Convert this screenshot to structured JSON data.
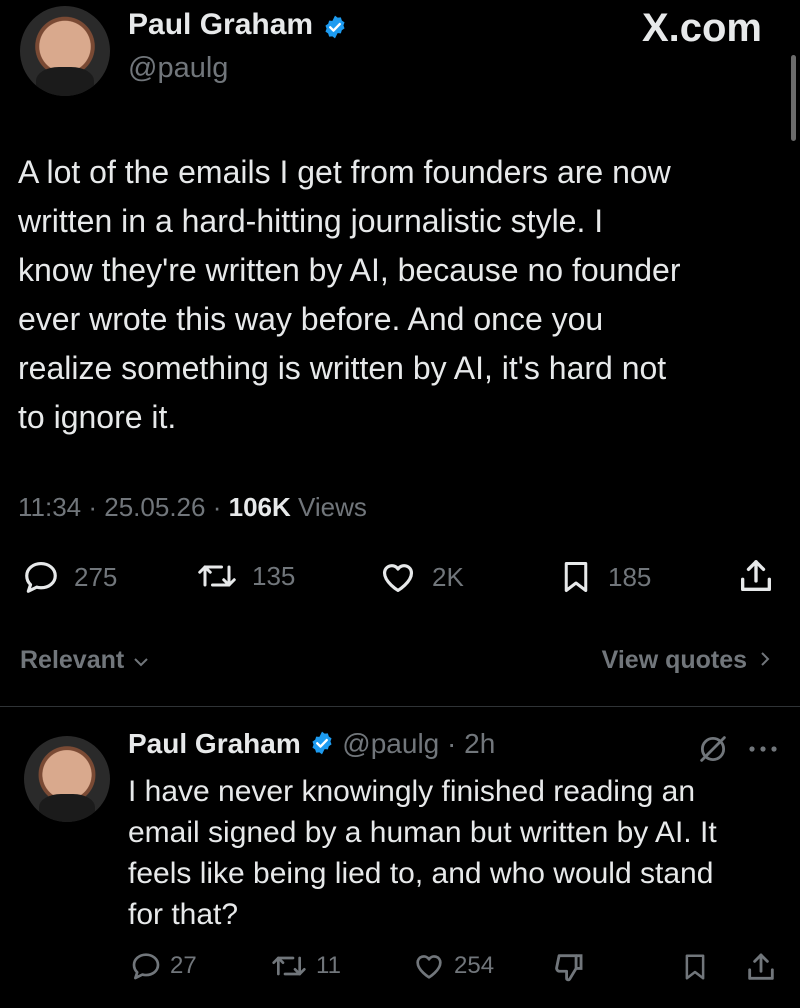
{
  "source_label": "X.com",
  "main_tweet": {
    "author_name": "Paul Graham",
    "handle": "@paulg",
    "text_lines": [
      "A lot of the emails I get from founders are now",
      "written in a hard-hitting journalistic style. I",
      "know they're written by AI, because no founder",
      "ever wrote this way before. And once you",
      "realize something is written by AI, it's hard not",
      "to ignore it."
    ],
    "time": "11:34",
    "date": "25.05.26",
    "views_count": "106K",
    "views_label": "Views",
    "replies": "275",
    "reposts": "135",
    "likes": "2K",
    "bookmarks": "185"
  },
  "sort": {
    "label": "Relevant",
    "view_quotes": "View quotes"
  },
  "reply": {
    "author_name": "Paul Graham",
    "handle": "@paulg",
    "age": "2h",
    "text_lines": [
      "I have never knowingly finished reading an",
      "email signed by a human but written by AI. It",
      "feels like being lied to, and who would stand",
      "for that?"
    ],
    "replies": "27",
    "reposts": "11",
    "likes": "254"
  },
  "colors": {
    "background": "#000000",
    "text": "#e7e9ea",
    "muted": "#71767b",
    "verified": "#1d9bf0"
  }
}
